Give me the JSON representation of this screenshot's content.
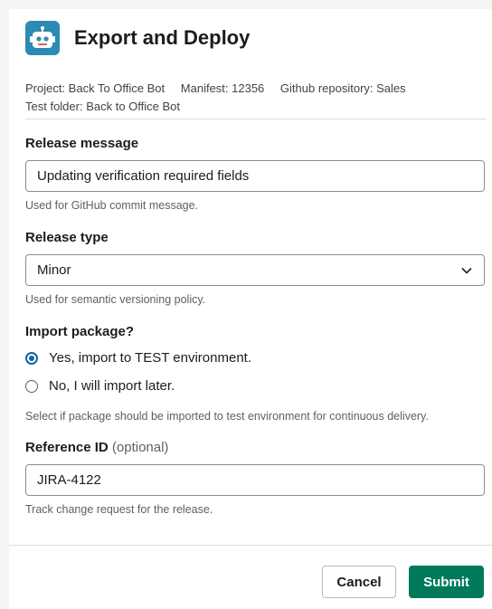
{
  "header": {
    "title": "Export and Deploy",
    "icon": "robot-icon"
  },
  "meta": {
    "project": "Project: Back To Office Bot",
    "manifest": "Manifest: 12356",
    "repository": "Github repository: Sales",
    "test_folder": "Test folder: Back to Office Bot"
  },
  "release_message": {
    "label": "Release message",
    "value": "Updating verification required fields",
    "hint": "Used for GitHub commit message."
  },
  "release_type": {
    "label": "Release type",
    "value": "Minor",
    "hint": "Used for semantic versioning policy."
  },
  "import_package": {
    "label": "Import package?",
    "options": [
      {
        "label": "Yes, import to TEST environment.",
        "checked": true
      },
      {
        "label": "No, I will import later.",
        "checked": false
      }
    ],
    "hint": "Select if package should be imported to test environment for continuous delivery."
  },
  "reference_id": {
    "label": "Reference ID",
    "optional": "(optional)",
    "value": "JIRA-4122",
    "hint": "Track change request for the release."
  },
  "footer": {
    "cancel_label": "Cancel",
    "submit_label": "Submit"
  },
  "colors": {
    "accent": "#1264a3",
    "submit": "#007a5a",
    "icon_bg": "#2b8bb5"
  }
}
